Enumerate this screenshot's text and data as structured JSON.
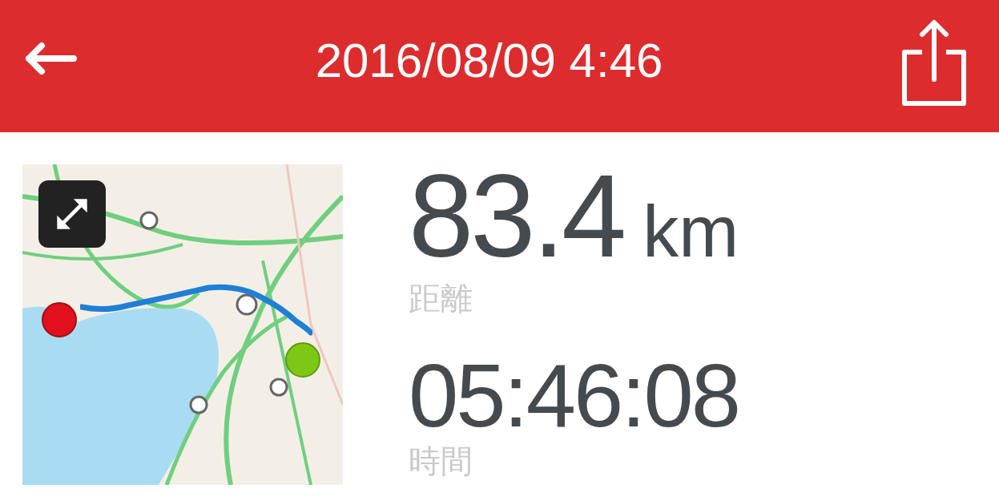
{
  "header": {
    "title": "2016/08/09 4:46"
  },
  "stats": [
    {
      "kind": "distance",
      "value": "83.4",
      "unit": "km",
      "label": "距離"
    },
    {
      "kind": "time",
      "value": "05:46:08",
      "label": "時間"
    }
  ]
}
